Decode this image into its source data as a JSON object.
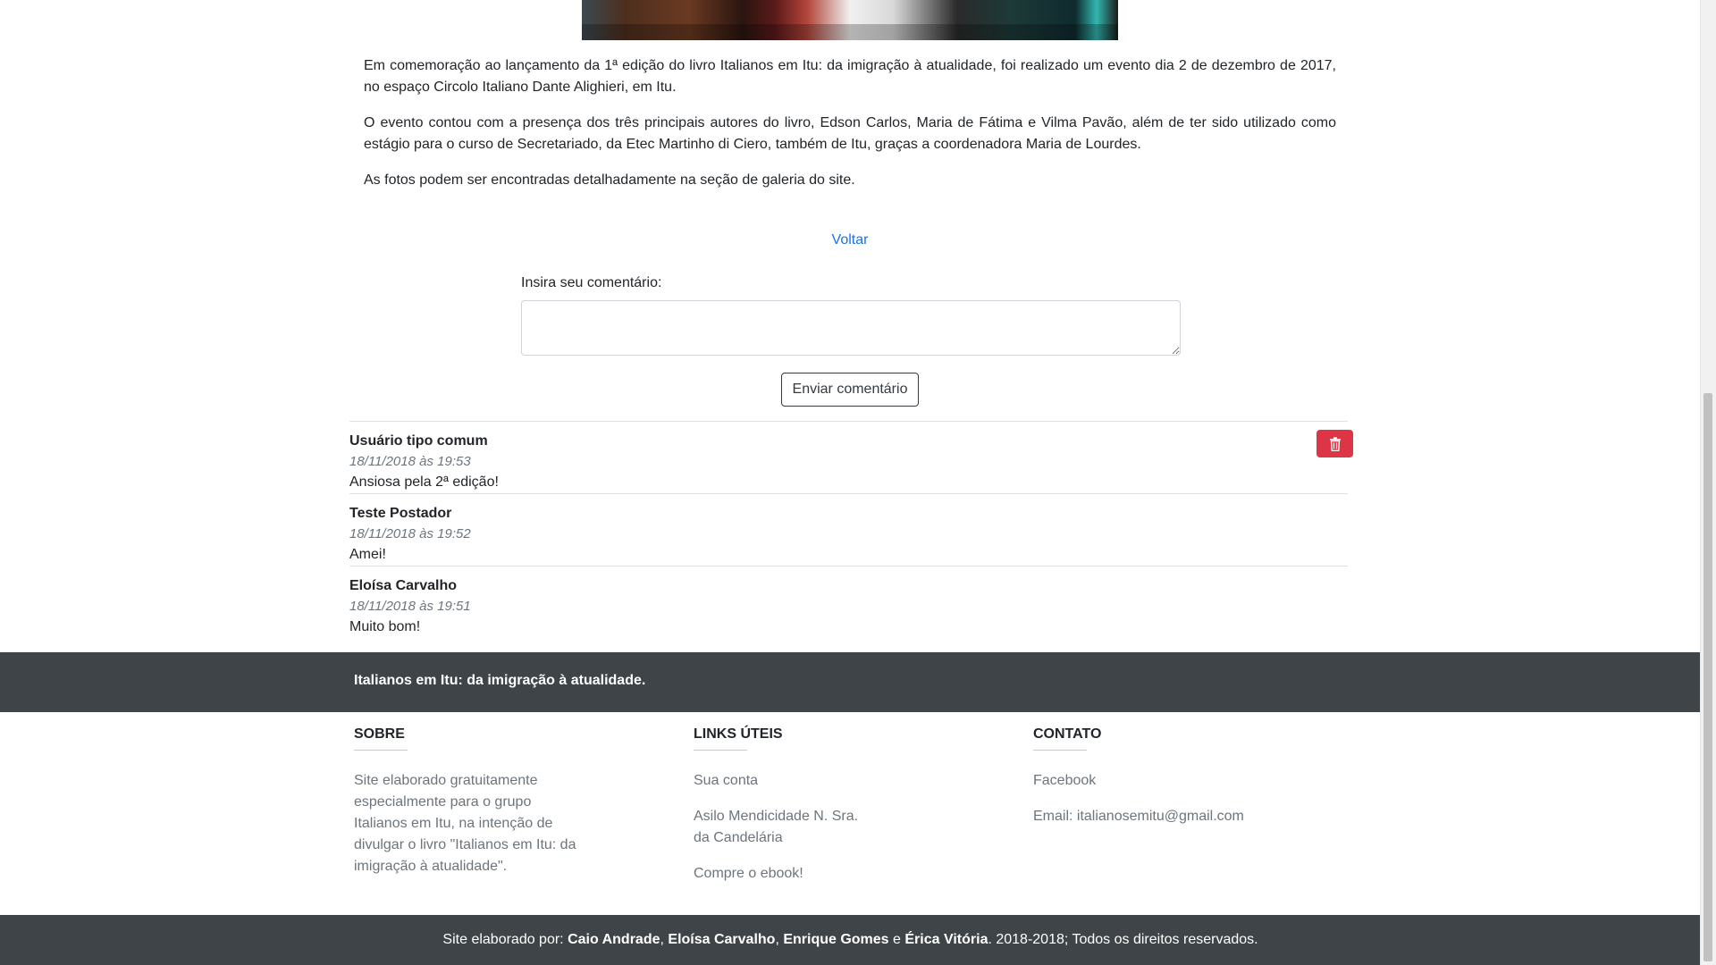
{
  "article": {
    "paragraphs": [
      "Em comemoração ao lançamento da 1ª edição do livro Italianos em Itu: da imigração à atualidade, foi realizado um evento dia 2 de dezembro de 2017, no espaço Circolo Italiano Dante Alighieri, em Itu.",
      "O evento contou com a presença dos três principais autores do livro, Edson Carlos, Maria de Fátima e Vilma Pavão, além de ter sido utilizado como estágio para o curso de Secretariado, da Etec Martinho di Ciero, também de Itu, graças a coordenadora Maria de Lourdes.",
      "As fotos podem ser encontradas detalhadamente na seção de galeria do site."
    ],
    "back_label": "Voltar"
  },
  "comment_form": {
    "label": "Insira seu comentário:",
    "value": "",
    "submit_label": "Enviar comentário"
  },
  "comments": [
    {
      "author": "Usuário tipo comum",
      "date": "18/11/2018 às 19:53",
      "text": "Ansiosa pela 2ª edição!",
      "can_delete": true
    },
    {
      "author": "Teste Postador",
      "date": "18/11/2018 às 19:52",
      "text": "Amei!",
      "can_delete": false
    },
    {
      "author": "Eloísa Carvalho",
      "date": "18/11/2018 às 19:51",
      "text": "Muito bom!",
      "can_delete": false
    }
  ],
  "footer": {
    "tagline": "Italianos em Itu: da imigração à atualidade.",
    "about": {
      "heading": "SOBRE",
      "text": "Site elaborado gratuitamente especialmente para o grupo Italianos em Itu, na intenção de divulgar o livro \"Italianos em Itu: da imigração à atualidade\"."
    },
    "links": {
      "heading": "LINKS ÚTEIS",
      "items": [
        "Sua conta",
        "Asilo Mendicidade N. Sra. da Candelária",
        "Compre o ebook!"
      ]
    },
    "contact": {
      "heading": "CONTATO",
      "items": [
        "Facebook",
        "Email: italianosemitu@gmail.com"
      ]
    },
    "credits": {
      "prefix": "Site elaborado por: ",
      "authors": [
        "Caio Andrade",
        "Eloísa Carvalho",
        "Enrique Gomes",
        "Érica Vitória"
      ],
      "sep1": ", ",
      "sep2": ", ",
      "sep3": " e ",
      "suffix": ". 2018-2018; Todos os direitos reservados."
    }
  },
  "colors": {
    "link": "#1a73e8",
    "danger": "#dc3545",
    "footer_dark": "#3e4447"
  },
  "icons": {
    "delete": "trash-icon"
  }
}
